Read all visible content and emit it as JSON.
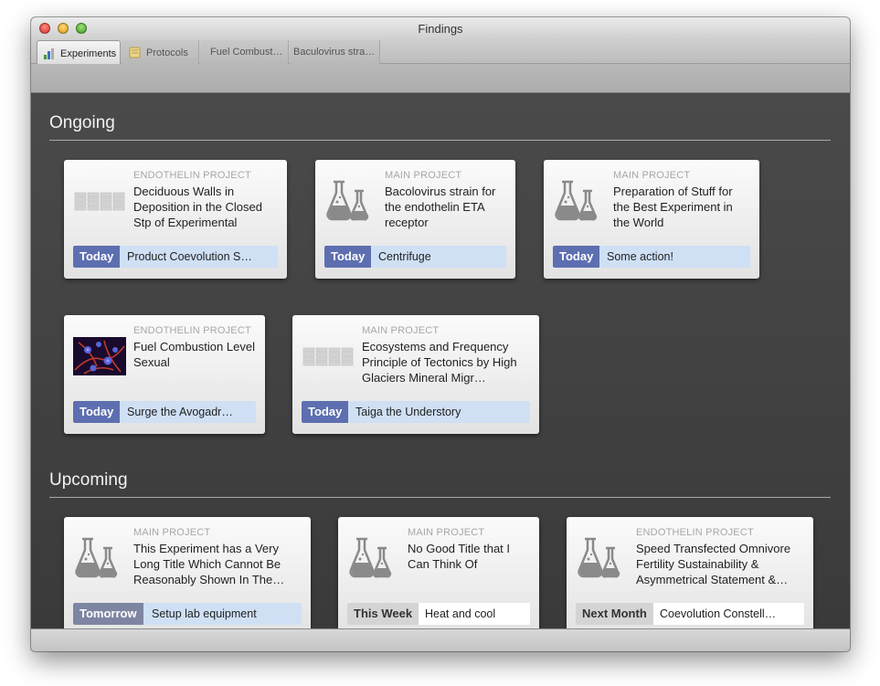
{
  "window": {
    "title": "Findings"
  },
  "tabs": [
    {
      "label": "Experiments",
      "icon": "experiments-icon",
      "active": true
    },
    {
      "label": "Protocols",
      "icon": "protocols-icon",
      "active": false
    },
    {
      "label": "Fuel Combust…",
      "icon": "",
      "active": false
    },
    {
      "label": "Baculovirus stra…",
      "icon": "",
      "active": false
    }
  ],
  "sections": {
    "ongoing": {
      "title": "Ongoing"
    },
    "upcoming": {
      "title": "Upcoming"
    }
  },
  "cards": [
    {
      "project": "ENDOTHELIN PROJECT",
      "title": "Deciduous Walls in Deposition in the Closed Stp of Experimental",
      "due": "Today",
      "task": "Product Coevolution S…",
      "thumb": "table-icon"
    },
    {
      "project": "MAIN PROJECT",
      "title": "Bacolovirus strain for the endothelin ETA receptor",
      "due": "Today",
      "task": "Centrifuge",
      "thumb": "flask-icon"
    },
    {
      "project": "MAIN PROJECT",
      "title": "Preparation of Stuff for the Best Experiment in the World",
      "due": "Today",
      "task": "Some action!",
      "thumb": "flask-icon"
    },
    {
      "project": "ENDOTHELIN PROJECT",
      "title": "Fuel Combustion Level Sexual",
      "due": "Today",
      "task": "Surge the Avogadr…",
      "thumb": "microscopy-image"
    },
    {
      "project": "MAIN PROJECT",
      "title": "Ecosystems and Frequency Principle of Tectonics by High Glaciers Mineral Migr…",
      "due": "Today",
      "task": "Taiga the Understory",
      "thumb": "table-icon"
    },
    {
      "project": "MAIN PROJECT",
      "title": "This Experiment has a Very Long Title Which Cannot Be Reasonably Shown In The…",
      "due": "Tomorrow",
      "task": "Setup lab equipment",
      "thumb": "flask-icon"
    },
    {
      "project": "MAIN PROJECT",
      "title": "No Good Title that I Can Think Of",
      "due": "This Week",
      "task": "Heat and cool",
      "thumb": "flask-icon"
    },
    {
      "project": "ENDOTHELIN PROJECT",
      "title": "Speed Transfected Omnivore Fertility Sustainability & Asymmetrical Statement &…",
      "due": "Next Month",
      "task": "Coevolution Constell…",
      "thumb": "flask-icon"
    }
  ],
  "colors": {
    "today_badge": "#5d6fb0",
    "due_bar": "#cfe0f5",
    "background": "#3d3d3d"
  }
}
